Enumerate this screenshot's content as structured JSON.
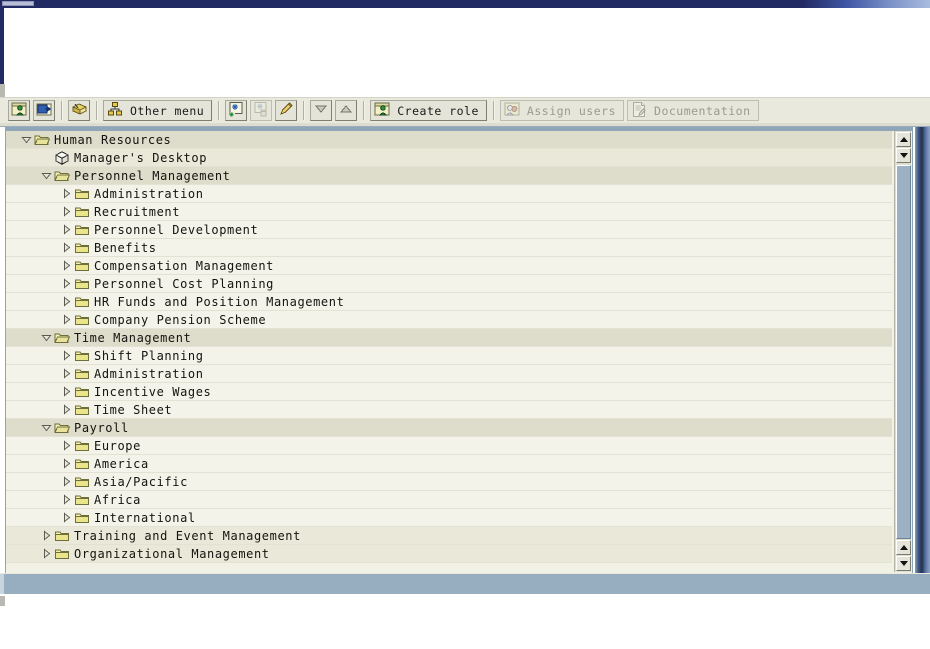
{
  "window": {
    "title_bar_color": "#212a62",
    "footer_band_color": "#97aec0"
  },
  "toolbar": {
    "buttons": [
      {
        "name": "create-role-icon-button",
        "icon": "role-person-icon",
        "label": "",
        "enabled": true,
        "type": "icon"
      },
      {
        "name": "display-window-button",
        "icon": "blue-window-icon",
        "label": "",
        "enabled": true,
        "type": "icon"
      },
      {
        "name": "separator-1",
        "icon": "separator",
        "label": "",
        "enabled": true,
        "type": "sep"
      },
      {
        "name": "transport-book-button",
        "icon": "yellow-book-icon",
        "label": "",
        "enabled": true,
        "type": "icon"
      },
      {
        "name": "separator-2",
        "icon": "separator",
        "label": "",
        "enabled": true,
        "type": "sep"
      },
      {
        "name": "other-menu-button",
        "icon": "hierarchy-icon",
        "label": "Other menu",
        "enabled": true,
        "type": "labeled"
      },
      {
        "name": "separator-3",
        "icon": "separator",
        "label": "",
        "enabled": true,
        "type": "sep"
      },
      {
        "name": "add-node-button",
        "icon": "add-node-icon",
        "label": "",
        "enabled": true,
        "type": "icon"
      },
      {
        "name": "delete-node-button",
        "icon": "delete-node-icon",
        "label": "",
        "enabled": false,
        "type": "icon"
      },
      {
        "name": "edit-node-button",
        "icon": "pencil-icon",
        "label": "",
        "enabled": true,
        "type": "icon"
      },
      {
        "name": "separator-4",
        "icon": "separator",
        "label": "",
        "enabled": true,
        "type": "sep"
      },
      {
        "name": "move-down-button",
        "icon": "arrow-down-icon",
        "label": "",
        "enabled": true,
        "type": "icon"
      },
      {
        "name": "move-up-button",
        "icon": "arrow-up-icon",
        "label": "",
        "enabled": true,
        "type": "icon"
      },
      {
        "name": "separator-5",
        "icon": "separator",
        "label": "",
        "enabled": true,
        "type": "sep"
      },
      {
        "name": "create-role-button",
        "icon": "role-person-icon",
        "label": "Create role",
        "enabled": true,
        "type": "labeled"
      },
      {
        "name": "separator-6",
        "icon": "separator",
        "label": "",
        "enabled": true,
        "type": "sep"
      },
      {
        "name": "assign-users-button",
        "icon": "users-group-icon",
        "label": "Assign users",
        "enabled": false,
        "type": "labeled"
      },
      {
        "name": "documentation-button",
        "icon": "document-pen-icon",
        "label": "Documentation",
        "enabled": false,
        "type": "labeled"
      }
    ]
  },
  "tree": {
    "rows": [
      {
        "label": "Human Resources",
        "depth": 0,
        "state": "expanded",
        "icon": "open-folder-icon",
        "shade": "a"
      },
      {
        "label": "Manager's Desktop",
        "depth": 1,
        "state": "leaf",
        "icon": "cube-icon",
        "shade": "b"
      },
      {
        "label": "Personnel Management",
        "depth": 1,
        "state": "expanded",
        "icon": "open-folder-icon",
        "shade": "a"
      },
      {
        "label": "Administration",
        "depth": 2,
        "state": "collapsed",
        "icon": "closed-folder-icon",
        "shade": "c"
      },
      {
        "label": "Recruitment",
        "depth": 2,
        "state": "collapsed",
        "icon": "closed-folder-icon",
        "shade": "c"
      },
      {
        "label": "Personnel Development",
        "depth": 2,
        "state": "collapsed",
        "icon": "closed-folder-icon",
        "shade": "c"
      },
      {
        "label": "Benefits",
        "depth": 2,
        "state": "collapsed",
        "icon": "closed-folder-icon",
        "shade": "c"
      },
      {
        "label": "Compensation Management",
        "depth": 2,
        "state": "collapsed",
        "icon": "closed-folder-icon",
        "shade": "c"
      },
      {
        "label": "Personnel Cost Planning",
        "depth": 2,
        "state": "collapsed",
        "icon": "closed-folder-icon",
        "shade": "c"
      },
      {
        "label": "HR Funds and Position Management",
        "depth": 2,
        "state": "collapsed",
        "icon": "closed-folder-icon",
        "shade": "c"
      },
      {
        "label": "Company Pension Scheme",
        "depth": 2,
        "state": "collapsed",
        "icon": "closed-folder-icon",
        "shade": "c"
      },
      {
        "label": "Time Management",
        "depth": 1,
        "state": "expanded",
        "icon": "open-folder-icon",
        "shade": "a"
      },
      {
        "label": "Shift Planning",
        "depth": 2,
        "state": "collapsed",
        "icon": "closed-folder-icon",
        "shade": "c"
      },
      {
        "label": "Administration",
        "depth": 2,
        "state": "collapsed",
        "icon": "closed-folder-icon",
        "shade": "c"
      },
      {
        "label": "Incentive Wages",
        "depth": 2,
        "state": "collapsed",
        "icon": "closed-folder-icon",
        "shade": "c"
      },
      {
        "label": "Time Sheet",
        "depth": 2,
        "state": "collapsed",
        "icon": "closed-folder-icon",
        "shade": "c"
      },
      {
        "label": "Payroll",
        "depth": 1,
        "state": "expanded",
        "icon": "open-folder-icon",
        "shade": "a"
      },
      {
        "label": "Europe",
        "depth": 2,
        "state": "collapsed",
        "icon": "closed-folder-icon",
        "shade": "c"
      },
      {
        "label": "America",
        "depth": 2,
        "state": "collapsed",
        "icon": "closed-folder-icon",
        "shade": "c"
      },
      {
        "label": "Asia/Pacific",
        "depth": 2,
        "state": "collapsed",
        "icon": "closed-folder-icon",
        "shade": "c"
      },
      {
        "label": "Africa",
        "depth": 2,
        "state": "collapsed",
        "icon": "closed-folder-icon",
        "shade": "c"
      },
      {
        "label": "International",
        "depth": 2,
        "state": "collapsed",
        "icon": "closed-folder-icon",
        "shade": "c"
      },
      {
        "label": "Training and Event Management",
        "depth": 1,
        "state": "collapsed",
        "icon": "closed-folder-icon",
        "shade": "b"
      },
      {
        "label": "Organizational Management",
        "depth": 1,
        "state": "collapsed",
        "icon": "closed-folder-icon",
        "shade": "b"
      }
    ]
  },
  "scrollbar": {
    "up_arrow": "scroll-up-icon",
    "down_arrow": "scroll-down-icon"
  }
}
